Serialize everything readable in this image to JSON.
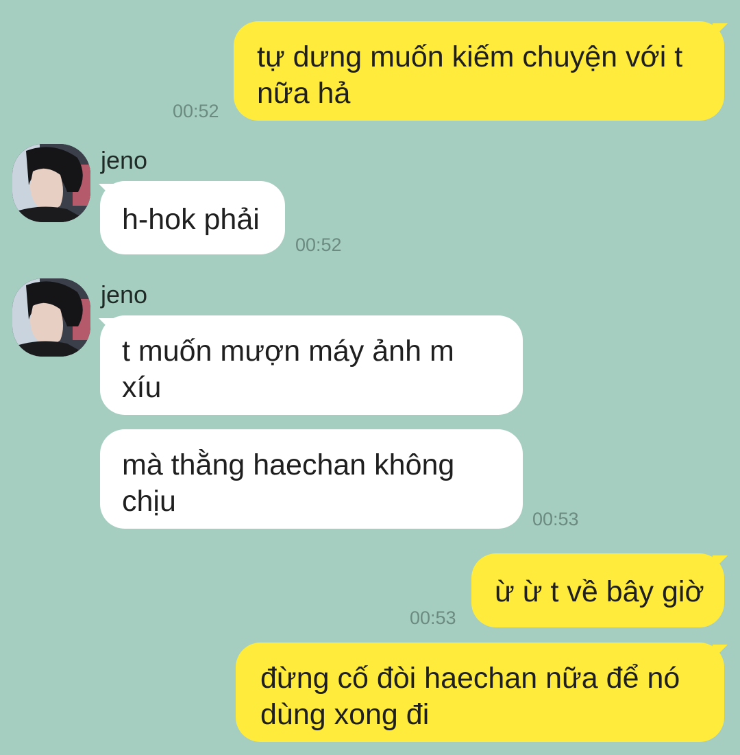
{
  "chat": {
    "messages": [
      {
        "side": "out",
        "text": "tự dưng muốn kiếm chuyện với t nữa hả",
        "time": "00:52"
      },
      {
        "side": "in",
        "sender": "jeno",
        "text": "h-hok phải",
        "time": "00:52"
      },
      {
        "side": "in",
        "sender": "jeno",
        "text": "t muốn mượn máy ảnh m xíu"
      },
      {
        "side": "in",
        "text": "mà thằng haechan không chịu",
        "time": "00:53"
      },
      {
        "side": "out",
        "text": "ừ ừ t về bây giờ",
        "time": "00:53"
      },
      {
        "side": "out",
        "text": "đừng cố đòi haechan nữa để nó dùng xong đi"
      }
    ]
  },
  "colors": {
    "background": "#a5cec1",
    "outgoing_bubble": "#ffeb3b",
    "incoming_bubble": "#ffffff",
    "timestamp": "#6b8a80"
  },
  "icons": {
    "avatar": "profile-photo"
  }
}
